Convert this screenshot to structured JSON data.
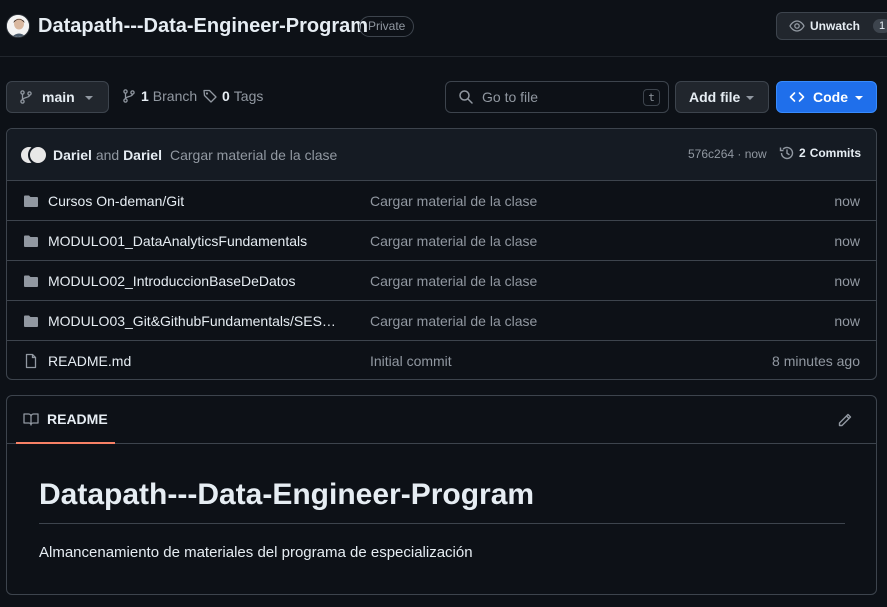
{
  "repo": {
    "name": "Datapath---Data-Engineer-Program",
    "visibility": "Private",
    "watch_label": "Unwatch",
    "watch_count": "1"
  },
  "toolbar": {
    "branch": "main",
    "branches_count": "1",
    "branches_label": "Branch",
    "tags_count": "0",
    "tags_label": "Tags",
    "search_placeholder": "Go to file",
    "search_shortcut": "t",
    "add_file_label": "Add file",
    "code_label": "Code",
    "accent_color": "#1f6feb"
  },
  "latest_commit": {
    "author1": "Dariel",
    "conjunction": "and",
    "author2": "Dariel",
    "message": "Cargar material de la clase",
    "sha_time": "576c264 · now",
    "commits_count": "2",
    "commits_label": "Commits"
  },
  "files": [
    {
      "type": "folder",
      "name": "Cursos On-deman/Git",
      "commit": "Cargar material de la clase",
      "age": "now"
    },
    {
      "type": "folder",
      "name": "MODULO01_DataAnalyticsFundamentals",
      "commit": "Cargar material de la clase",
      "age": "now"
    },
    {
      "type": "folder",
      "name": "MODULO02_IntroduccionBaseDeDatos",
      "commit": "Cargar material de la clase",
      "age": "now"
    },
    {
      "type": "folder",
      "name": "MODULO03_Git&GithubFundamentals/SESIO…",
      "commit": "Cargar material de la clase",
      "age": "now"
    },
    {
      "type": "file",
      "name": "README.md",
      "commit": "Initial commit",
      "age": "8 minutes ago"
    }
  ],
  "readme": {
    "tab_label": "README",
    "title": "Datapath---Data-Engineer-Program",
    "description": "Almancenamiento de materiales del programa de especialización"
  }
}
